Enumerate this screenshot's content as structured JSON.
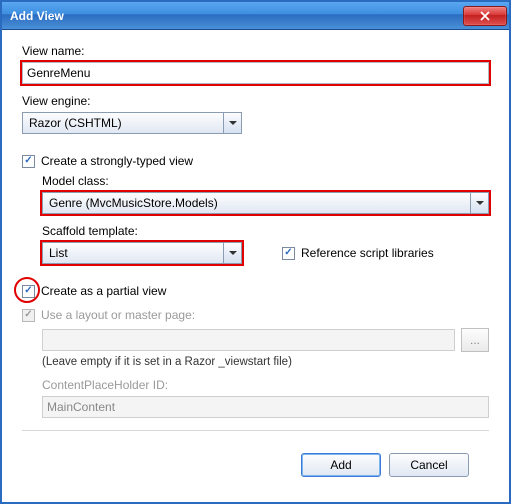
{
  "window": {
    "title": "Add View",
    "close_tooltip": "Close"
  },
  "view_name": {
    "label": "View name:",
    "value": "GenreMenu"
  },
  "view_engine": {
    "label": "View engine:",
    "value": "Razor (CSHTML)"
  },
  "strongly_typed": {
    "label": "Create a strongly-typed view",
    "checked": true
  },
  "model_class": {
    "label": "Model class:",
    "value": "Genre (MvcMusicStore.Models)"
  },
  "scaffold": {
    "label": "Scaffold template:",
    "value": "List"
  },
  "ref_scripts": {
    "label": "Reference script libraries",
    "checked": true
  },
  "partial_view": {
    "label": "Create as a partial view",
    "checked": true
  },
  "layout": {
    "label": "Use a layout or master page:",
    "checked": true,
    "value": "",
    "browse": "...",
    "hint": "(Leave empty if it is set in a Razor _viewstart file)"
  },
  "cph": {
    "label": "ContentPlaceHolder ID:",
    "value": "MainContent"
  },
  "buttons": {
    "add": "Add",
    "cancel": "Cancel"
  }
}
